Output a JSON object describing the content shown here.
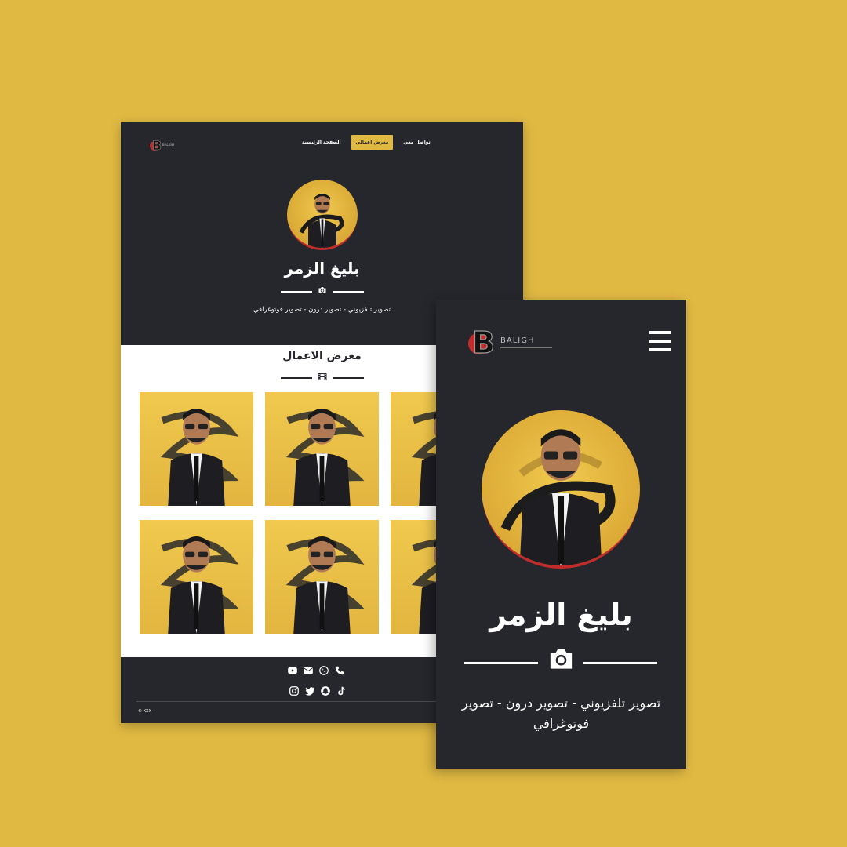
{
  "desktop": {
    "brand": {
      "logo_letter": "B",
      "logo_text": "BALIGH"
    },
    "nav": {
      "items": [
        {
          "label": "الصفحة الرئيسية",
          "active": false
        },
        {
          "label": "معرض اعمالي",
          "active": true
        },
        {
          "label": "تواصل معي",
          "active": false
        }
      ]
    },
    "hero": {
      "name": "بليغ الزمر",
      "divider_icon": "camera-icon",
      "subtitle": "تصوير تلفزيوني - تصوير درون - تصوير فوتوغرافي"
    },
    "gallery": {
      "title": "معرض الاعمال",
      "divider_icon": "film-icon",
      "thumbnails": 6
    },
    "footer": {
      "social_row1": [
        "youtube-icon",
        "email-icon",
        "whatsapp-icon",
        "phone-icon"
      ],
      "social_row2": [
        "instagram-icon",
        "twitter-icon",
        "snapchat-icon",
        "tiktok-icon"
      ],
      "copyright": "© XXX"
    }
  },
  "mobile": {
    "brand": {
      "logo_letter": "B",
      "logo_text": "BALIGH"
    },
    "menu_icon": "hamburger-icon",
    "hero": {
      "name": "بليغ الزمر",
      "divider_icon": "camera-icon",
      "subtitle": "تصوير تلفزيوني - تصوير درون - تصوير فوتوغرافي"
    }
  },
  "colors": {
    "background": "#e0b942",
    "dark": "#26272c",
    "accent": "#e0b942",
    "red": "#c22b2b",
    "white": "#ffffff"
  }
}
